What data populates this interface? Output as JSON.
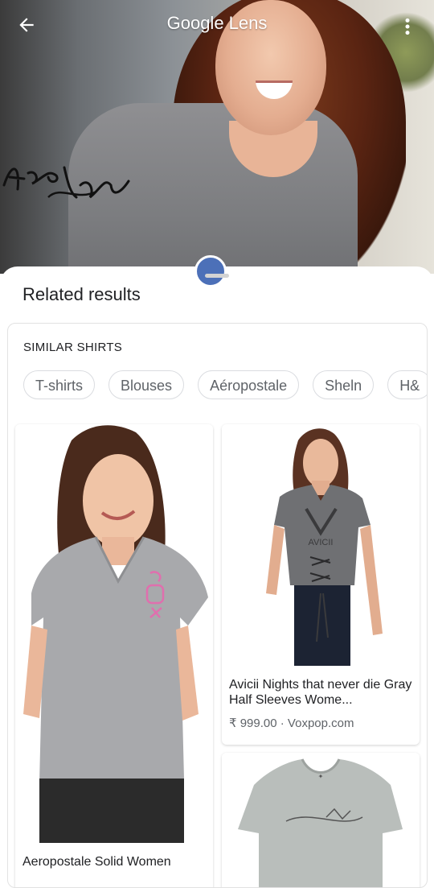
{
  "app": {
    "title": "Google Lens"
  },
  "icons": {
    "back": "arrow-left-icon",
    "more": "more-vert-icon"
  },
  "hero": {
    "signature": "Avril Hal"
  },
  "sheet": {
    "title": "Related results"
  },
  "similar": {
    "label": "SIMILAR SHIRTS",
    "chips": [
      "T-shirts",
      "Blouses",
      "Aéropostale",
      "Sheln",
      "H&"
    ]
  },
  "products": [
    {
      "title": "Aeropostale Solid Women",
      "price": "",
      "source": ""
    },
    {
      "title": "Avicii Nights that never die Gray Half Sleeves Wome...",
      "price": "₹ 999.00",
      "source": "Voxpop.com",
      "price_line": "₹ 999.00 · Voxpop.com",
      "shirt_print": "AVICII"
    },
    {
      "title": "",
      "price": "",
      "source": ""
    }
  ],
  "colors": {
    "accent": "#4c70b8",
    "chip_border": "#dadce0",
    "text": "#202124",
    "subtext": "#5f6368"
  }
}
